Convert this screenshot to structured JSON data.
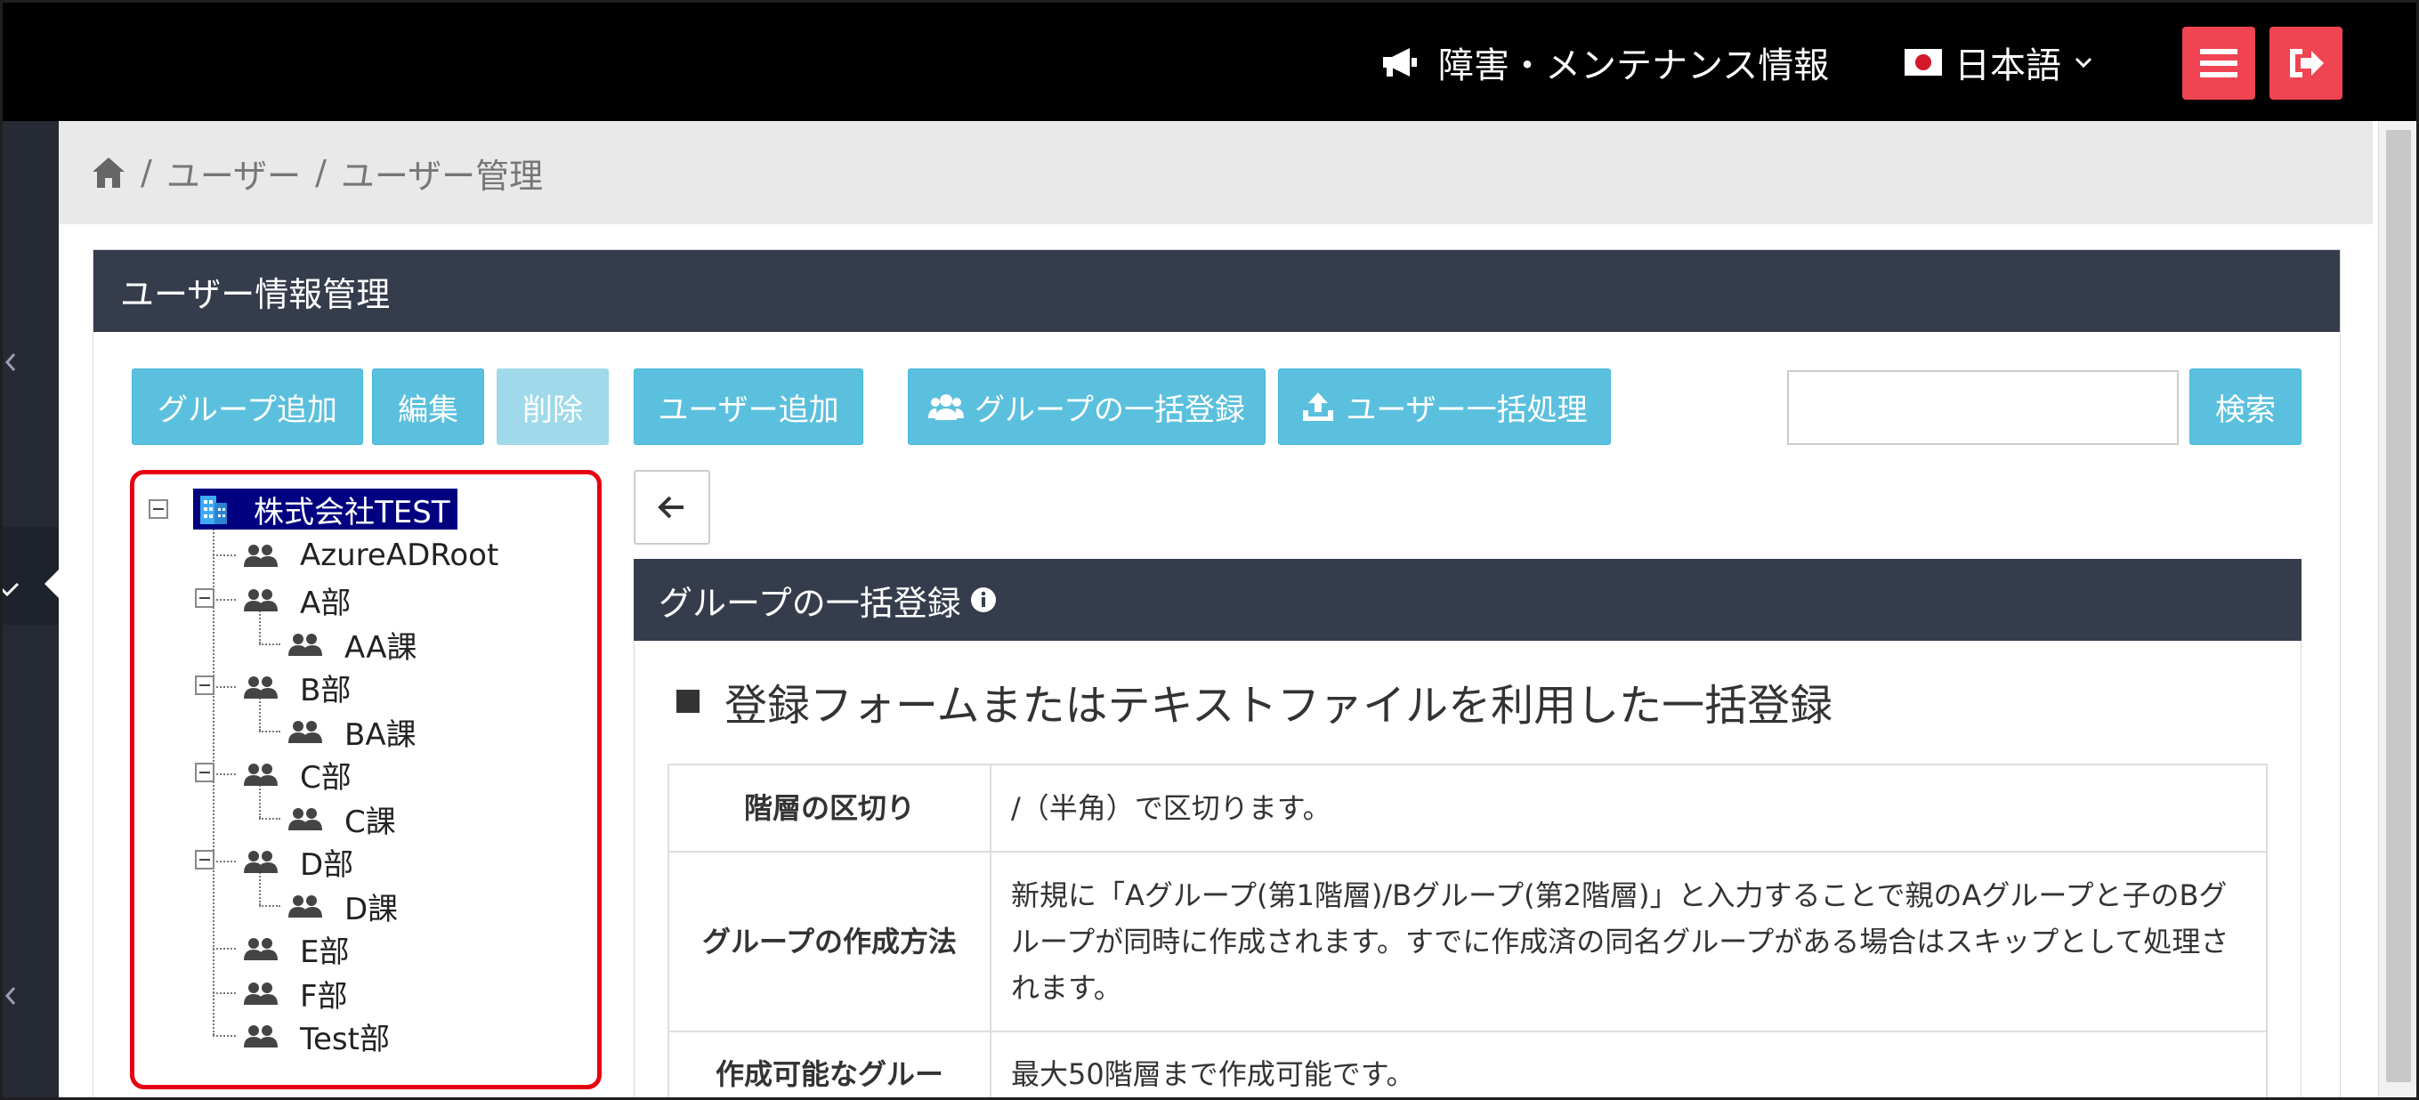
{
  "header": {
    "notice_label": "障害・メンテナンス情報",
    "language_label": "日本語"
  },
  "breadcrumb": {
    "items": [
      "ユーザー",
      "ユーザー管理"
    ],
    "separator": "/"
  },
  "panel": {
    "title": "ユーザー情報管理"
  },
  "toolbar": {
    "add_group": "グループ追加",
    "edit": "編集",
    "delete": "削除",
    "add_user": "ユーザー追加",
    "bulk_group": "グループの一括登録",
    "bulk_user": "ユーザー一括処理",
    "search_value": "",
    "search": "検索"
  },
  "tree": {
    "root": "株式会社TEST",
    "nodes": [
      "AzureADRoot",
      "A部",
      "AA課",
      "B部",
      "BA課",
      "C部",
      "C課",
      "D部",
      "D課",
      "E部",
      "F部",
      "Test部"
    ]
  },
  "content": {
    "subheader": "グループの一括登録",
    "section_title": "登録フォームまたはテキストファイルを利用した一括登録",
    "rows": [
      {
        "label": "階層の区切り",
        "value": "/（半角）で区切ります。"
      },
      {
        "label": "グループの作成方法",
        "value": "新規に「Aグループ(第1階層)/Bグループ(第2階層)」と入力することで親のAグループと子のBグループが同時に作成されます。すでに作成済の同名グループがある場合はスキップとして処理されます。"
      },
      {
        "label": "作成可能なグルー",
        "value": "最大50階層まで作成可能です。"
      }
    ]
  },
  "colors": {
    "topbar": "#000000",
    "accent_red": "#f04452",
    "button_info": "#5bc0de",
    "panel_header": "#353c4c",
    "tree_highlight": "#000080",
    "callout_border": "#e60012"
  }
}
